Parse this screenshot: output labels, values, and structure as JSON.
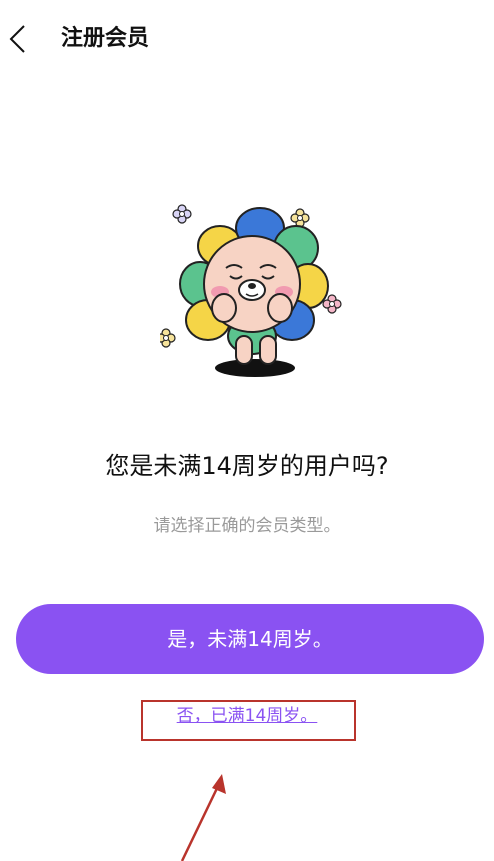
{
  "header": {
    "back_icon": "chevron-left-icon",
    "title": "注册会员"
  },
  "illustration": {
    "icon": "flower-lion-mascot"
  },
  "main": {
    "question": "您是未满14周岁的用户吗?",
    "subtitle": "请选择正确的会员类型。",
    "yes_label": "是，未满14周岁。",
    "no_label": "否，已满14周岁。"
  },
  "colors": {
    "accent": "#8a52f2",
    "annotation": "#b9342c",
    "subtitle": "#9a9a9a"
  }
}
